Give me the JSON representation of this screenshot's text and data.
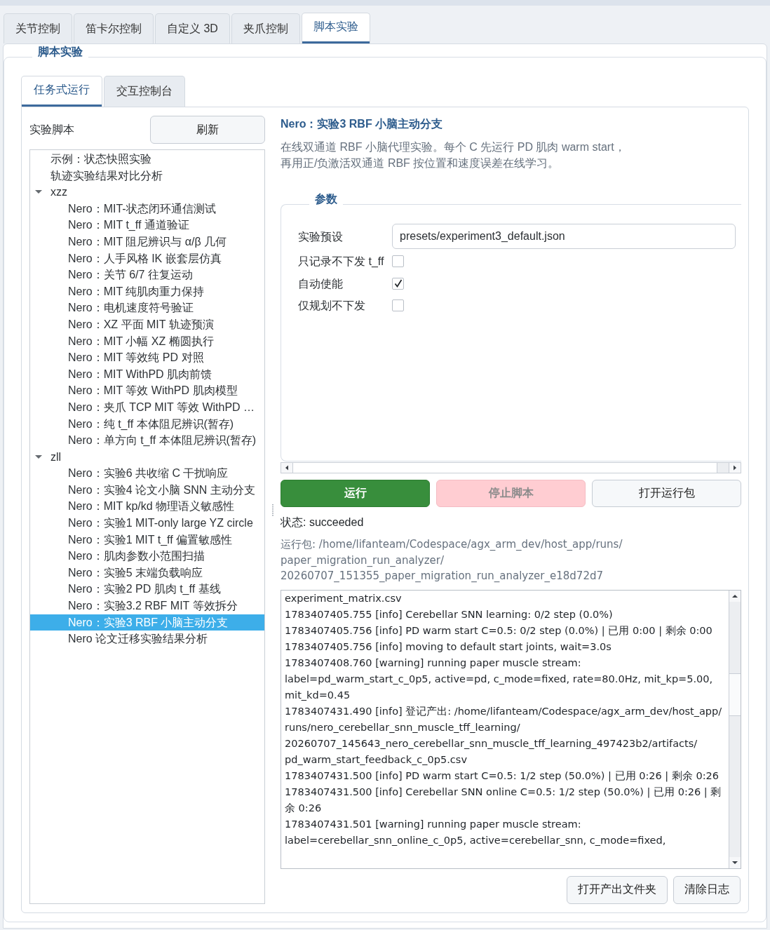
{
  "tabs": [
    {
      "label": "关节控制",
      "selected": false
    },
    {
      "label": "笛卡尔控制",
      "selected": false
    },
    {
      "label": "自定义 3D",
      "selected": false
    },
    {
      "label": "夹爪控制",
      "selected": false
    },
    {
      "label": "脚本实验",
      "selected": true
    }
  ],
  "group": {
    "title": "脚本实验"
  },
  "subtabs": [
    {
      "label": "任务式运行",
      "selected": true
    },
    {
      "label": "交互控制台",
      "selected": false
    }
  ],
  "scripts": {
    "label": "实验脚本",
    "refresh_button": "刷新",
    "tree": [
      {
        "label": "示例：状态快照实验",
        "selected": false
      },
      {
        "label": "轨迹实验结果对比分析",
        "selected": false
      },
      {
        "label": "xzz",
        "selected": false,
        "expanded": true,
        "children": [
          {
            "label": "Nero：MIT-状态闭环通信测试",
            "selected": false
          },
          {
            "label": "Nero：MIT t_ff 通道验证",
            "selected": false
          },
          {
            "label": "Nero：MIT 阻尼辨识与 α/β 几何",
            "selected": false
          },
          {
            "label": "Nero：人手风格 IK 嵌套层仿真",
            "selected": false
          },
          {
            "label": "Nero：关节 6/7 往复运动",
            "selected": false
          },
          {
            "label": "Nero：MIT 纯肌肉重力保持",
            "selected": false
          },
          {
            "label": "Nero：电机速度符号验证",
            "selected": false
          },
          {
            "label": "Nero：XZ 平面 MIT 轨迹预演",
            "selected": false
          },
          {
            "label": "Nero：MIT 小幅 XZ 椭圆执行",
            "selected": false
          },
          {
            "label": "Nero：MIT 等效纯 PD 对照",
            "selected": false
          },
          {
            "label": "Nero：MIT WithPD 肌肉前馈",
            "selected": false
          },
          {
            "label": "Nero：MIT 等效 WithPD 肌肉模型",
            "selected": false
          },
          {
            "label": "Nero：夹爪 TCP MIT 等效 WithPD …",
            "selected": false
          },
          {
            "label": "Nero：纯 t_ff 本体阻尼辨识(暂存)",
            "selected": false
          },
          {
            "label": "Nero：单方向 t_ff 本体阻尼辨识(暂存)",
            "selected": false
          }
        ]
      },
      {
        "label": "zll",
        "selected": false,
        "expanded": true,
        "children": [
          {
            "label": "Nero：实验6 共收缩 C 干扰响应",
            "selected": false
          },
          {
            "label": "Nero：实验4 论文小脑 SNN 主动分支",
            "selected": false
          },
          {
            "label": "Nero：MIT kp/kd 物理语义敏感性",
            "selected": false
          },
          {
            "label": "Nero：实验1 MIT-only large YZ circle",
            "selected": false
          },
          {
            "label": "Nero：实验1 MIT t_ff 偏置敏感性",
            "selected": false
          },
          {
            "label": "Nero：肌肉参数小范围扫描",
            "selected": false
          },
          {
            "label": "Nero：实验5 末端负载响应",
            "selected": false
          },
          {
            "label": "Nero：实验2 PD 肌肉 t_ff 基线",
            "selected": false
          },
          {
            "label": "Nero：实验3.2 RBF MIT 等效拆分",
            "selected": false
          },
          {
            "label": "Nero：实验3 RBF 小脑主动分支",
            "selected": true
          },
          {
            "label": "Nero 论文迁移实验结果分析",
            "selected": false
          }
        ]
      }
    ]
  },
  "detail": {
    "title": "Nero：实验3 RBF 小脑主动分支",
    "description": [
      "在线双通道 RBF 小脑代理实验。每个 C 先运行 PD 肌肉 warm start，",
      "再用正/负激活双通道 RBF 按位置和速度误差在线学习。"
    ]
  },
  "params": {
    "title": "参数",
    "rows": [
      {
        "kind": "field",
        "label": "实验预设",
        "value": "presets/experiment3_default.json"
      },
      {
        "kind": "checkbox",
        "label": "只记录不下发 t_ff",
        "checked": false
      },
      {
        "kind": "checkbox",
        "label": "自动使能",
        "checked": true
      },
      {
        "kind": "checkbox",
        "label": "仅规划不下发",
        "checked": false
      }
    ]
  },
  "actions": [
    {
      "kind": "run",
      "label": "运行",
      "disabled": false
    },
    {
      "kind": "stop",
      "label": "停止脚本",
      "disabled": true
    },
    {
      "kind": "open",
      "label": "打开运行包",
      "disabled": false
    }
  ],
  "status": "状态: succeeded",
  "run_package": "运行包: /home/lifanteam/Codespace/agx_arm_dev/host_app/runs/paper_migration_run_analyzer/20260707_151355_paper_migration_run_analyzer_e18d72d7",
  "log": [
    "experiment_matrix.csv",
    "1783407405.755 [info] Cerebellar SNN learning: 0/2 step (0.0%)",
    "1783407405.756 [info] PD warm start C=0.5: 0/2 step (0.0%) | 已用 0:00 | 剩余 0:00",
    "1783407405.756 [info] moving to default start joints, wait=3.0s",
    "1783407408.760 [warning] running paper muscle stream: label=pd_warm_start_c_0p5, active=pd, c_mode=fixed, rate=80.0Hz, mit_kp=5.00, mit_kd=0.45",
    "1783407431.490 [info] 登记产出: /home/lifanteam/Codespace/agx_arm_dev/host_app/runs/nero_cerebellar_snn_muscle_tff_learning/20260707_145643_nero_cerebellar_snn_muscle_tff_learning_497423b2/artifacts/pd_warm_start_feedback_c_0p5.csv",
    "1783407431.500 [info] PD warm start C=0.5: 1/2 step (50.0%) | 已用 0:26 | 剩余 0:26",
    "1783407431.500 [info] Cerebellar SNN online C=0.5: 1/2 step (50.0%) | 已用 0:26 | 剩余 0:26",
    "1783407431.501 [warning] running paper muscle stream: label=cerebellar_snn_online_c_0p5, active=cerebellar_snn, c_mode=fixed,"
  ],
  "log_buttons": [
    "打开产出文件夹",
    "清除日志"
  ]
}
